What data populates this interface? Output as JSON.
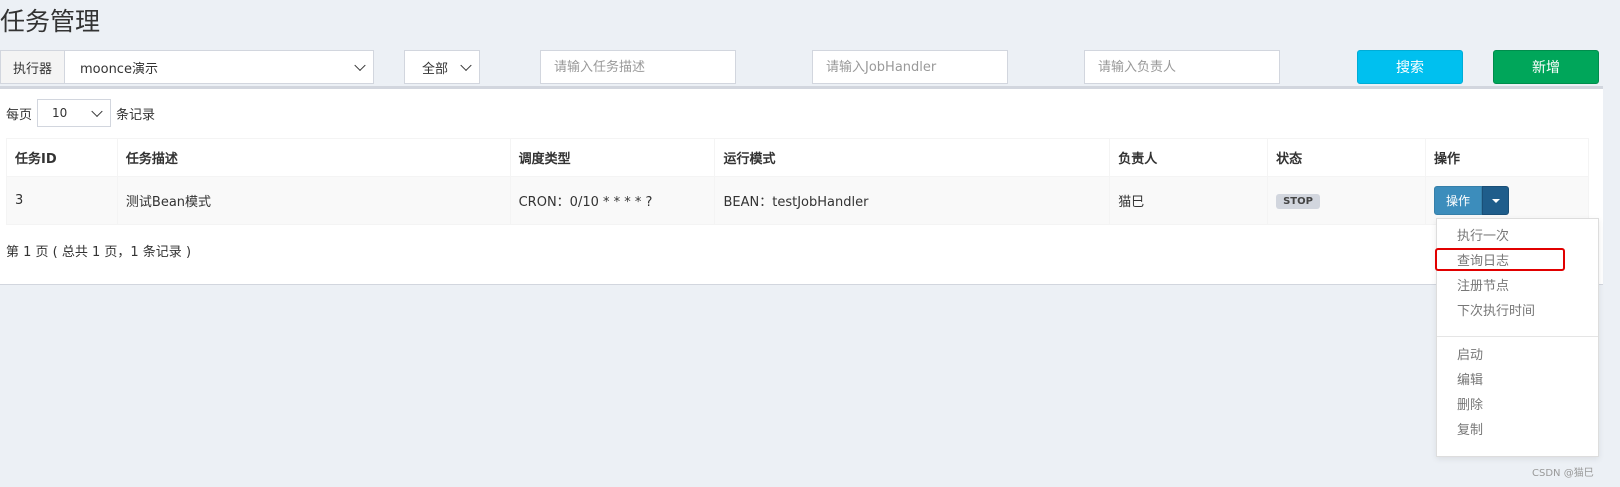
{
  "page": {
    "title": "任务管理"
  },
  "filters": {
    "executor_label": "执行器",
    "executor_value": "moonce演示",
    "status_value": "全部",
    "desc_placeholder": "请输入任务描述",
    "handler_placeholder": "请输入JobHandler",
    "author_placeholder": "请输入负责人",
    "search_label": "搜索",
    "add_label": "新增"
  },
  "table": {
    "per_page_prefix": "每页",
    "per_page_value": "10",
    "per_page_suffix": "条记录",
    "headers": [
      "任务ID",
      "任务描述",
      "调度类型",
      "运行模式",
      "负责人",
      "状态",
      "操作"
    ],
    "rows": [
      {
        "id": "3",
        "desc": "测试Bean模式",
        "schedule": "CRON：0/10 * * * * ?",
        "mode": "BEAN：testJobHandler",
        "author": "猫巳",
        "status": "STOP",
        "action": "操作"
      }
    ],
    "pagination": "第 1 页 ( 总共 1 页，1 条记录 )"
  },
  "menu": {
    "items": [
      "执行一次",
      "查询日志",
      "注册节点",
      "下次执行时间",
      "启动",
      "编辑",
      "删除",
      "复制"
    ]
  },
  "watermark": "CSDN @猫巳",
  "colors": {
    "search": "#00c0ef",
    "add": "#00a65a",
    "action": "#3c8dbc",
    "highlight": "#e10000"
  }
}
